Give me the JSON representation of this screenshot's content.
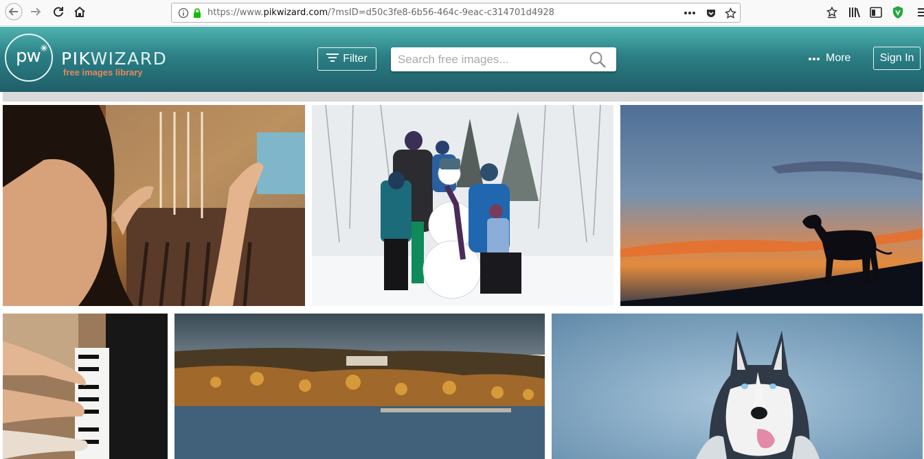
{
  "browser": {
    "url_prefix": "https://www.",
    "url_host": "pikwizard.com",
    "url_path": "/?msID=d50c3fe8-6b56-464c-9eac-c314701d4928",
    "icons": [
      "back-icon",
      "forward-icon",
      "reload-icon",
      "home-icon",
      "info-icon",
      "lock-icon",
      "page-actions-icon",
      "pocket-icon",
      "bookmark-star-icon",
      "reader-icon",
      "library-icon",
      "sidebar-icon",
      "shield-extension-icon",
      "menu-icon"
    ]
  },
  "header": {
    "logo_mark": "pw",
    "logo_name_a": "PIK",
    "logo_name_b": "WIZARD",
    "logo_tagline": "free images library",
    "filter_label": "Filter",
    "search_placeholder": "Search free images...",
    "more_label": "More",
    "signin_label": "Sign In"
  },
  "colors": {
    "header_top": "#4fb3b0",
    "header_bottom": "#1f5e68",
    "tagline": "#e8865a",
    "lock_green": "#12bc00"
  },
  "gallery": {
    "row1": [
      "woman-browsing-jewelry-photo",
      "family-snowman-photo",
      "dog-silhouette-sunset-photo"
    ],
    "row2": [
      "piano-hands-photo",
      "coastal-town-autumn-photo",
      "husky-dog-photo"
    ]
  }
}
